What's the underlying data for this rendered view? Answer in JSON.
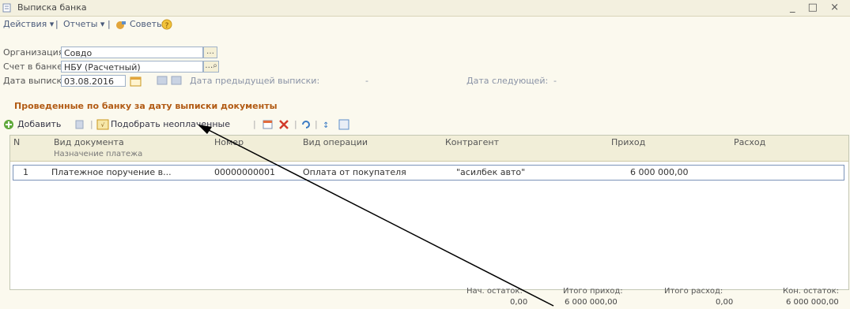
{
  "window": {
    "title": "Выписка банка",
    "buttons": "_ □ ×"
  },
  "menu": {
    "actions": "Действия ▾",
    "reports": "Отчеты ▾",
    "advice": "Советы"
  },
  "form": {
    "org_label": "Организация:",
    "org_value": "Совдо",
    "account_label": "Счет в банке:",
    "account_value": "НБУ (Расчетный)",
    "date_label": "Дата выписки:",
    "date_value": "03.08.2016",
    "prev_label": "Дата предыдущей выписки:",
    "prev_value": "-",
    "next_label": "Дата следующей:",
    "next_value": "-"
  },
  "subheader": "Проведенные по банку за дату выписки документы",
  "toolbar": {
    "add": "Добавить",
    "pick_unpaid": "Подобрать неоплаченные"
  },
  "grid": {
    "headers": [
      "N",
      "Вид документа",
      "Номер",
      "Вид операции",
      "Контрагент",
      "Приход",
      "Расход"
    ],
    "sub_header": "Назначение платежа",
    "rows": [
      {
        "n": "1",
        "doc_type": "Платежное поручение в...",
        "number": "00000000001",
        "operation": "Оплата от покупателя",
        "counterparty": "\"асилбек авто\"",
        "income": "6 000 000,00",
        "expense": ""
      }
    ]
  },
  "totals": {
    "start_label": "Нач. остаток:",
    "start_value": "0,00",
    "income_label": "Итого приход:",
    "income_value": "6 000 000,00",
    "expense_label": "Итого расход:",
    "expense_value": "0,00",
    "end_label": "Кон. остаток:",
    "end_value": "6 000 000,00"
  }
}
